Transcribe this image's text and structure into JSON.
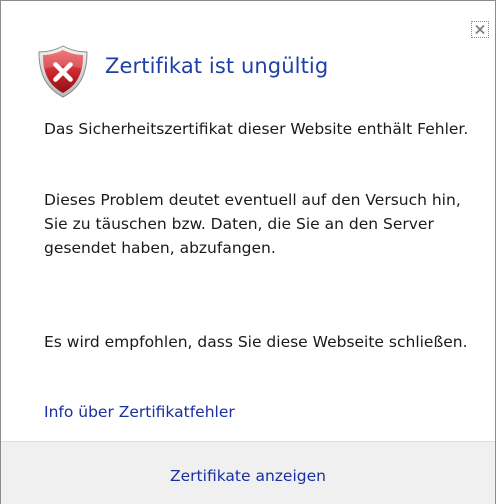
{
  "dialog": {
    "title": "Zertifikat ist ungültig",
    "paragraph1": "Das Sicherheitszertifikat dieser Website enthält Fehler.",
    "paragraph2": "Dieses Problem deutet eventuell auf den Versuch hin, Sie zu täuschen bzw. Daten, die Sie an den Server gesendet haben, abzufangen.",
    "paragraph3": "Es wird empfohlen, dass Sie diese Webseite schließen.",
    "info_link": "Info über Zertifikatfehler",
    "footer_link": "Zertifikate anzeigen",
    "icons": {
      "status": "error-shield-icon",
      "close": "close-icon"
    },
    "colors": {
      "title": "#1f3fa6",
      "link": "#1a2fa0",
      "shield": "#c8242b",
      "footer_bg": "#f0f0f0"
    }
  }
}
